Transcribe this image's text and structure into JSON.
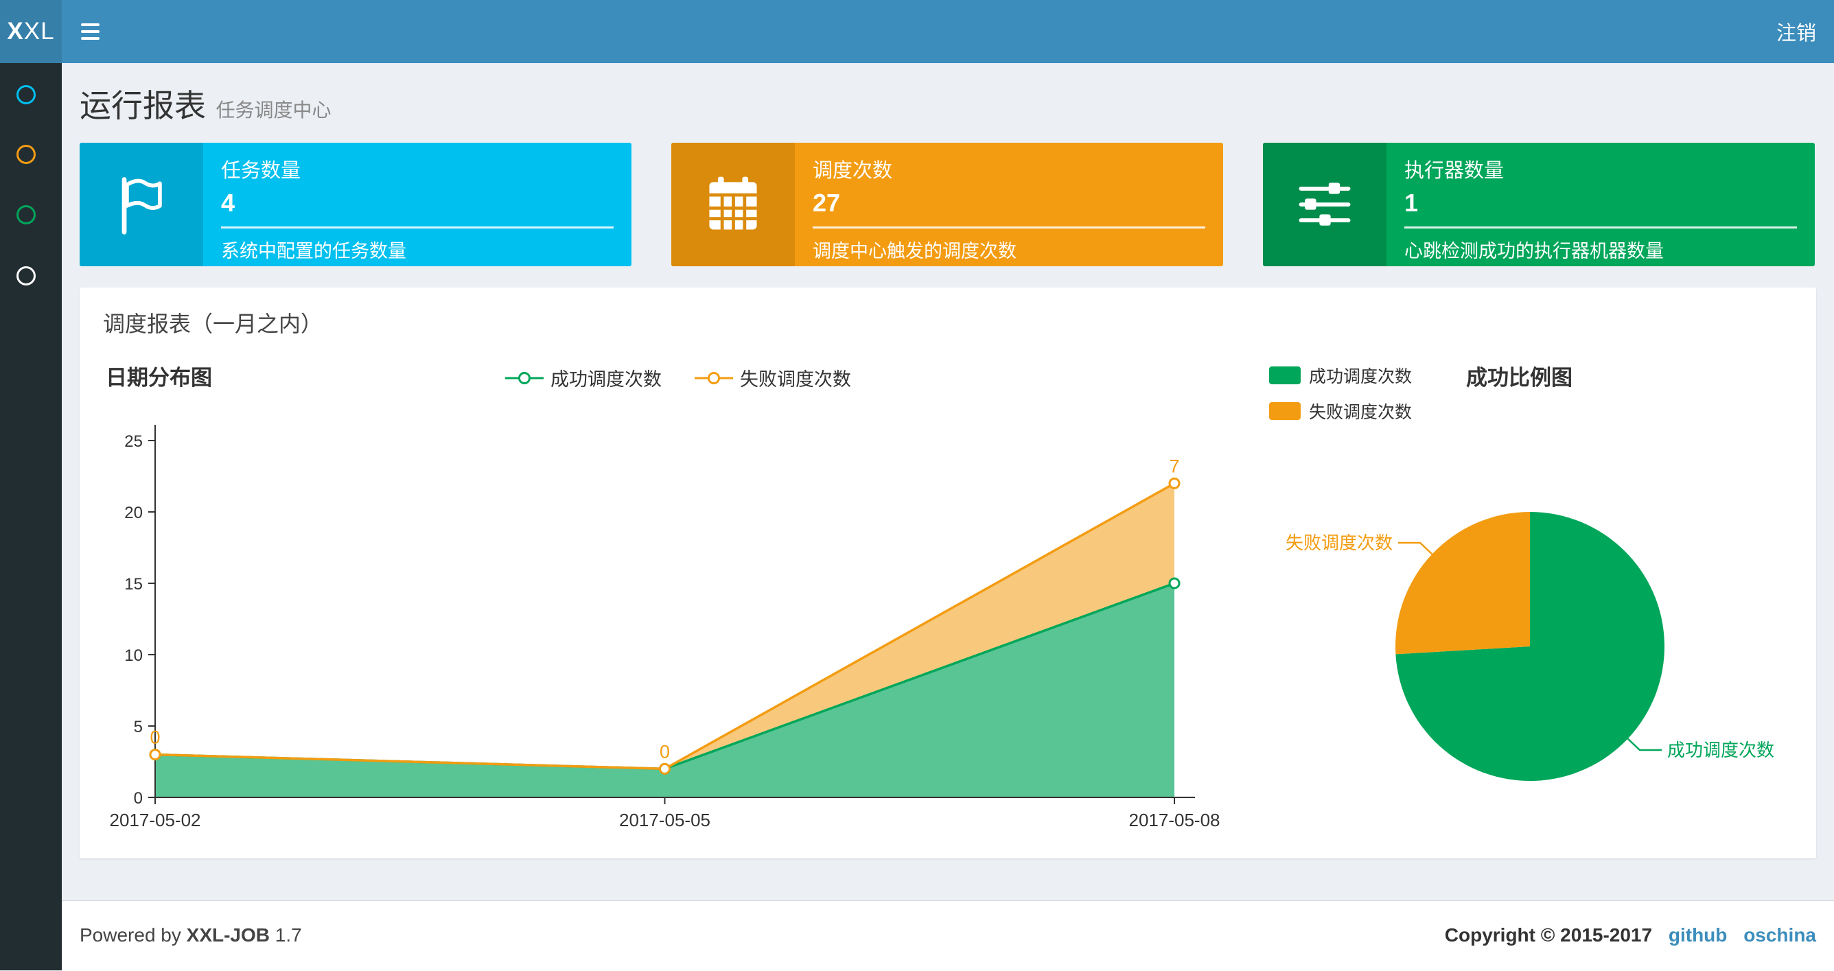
{
  "colors": {
    "navbar_bg": "#3c8dbc",
    "logo_bg": "#367fa9",
    "sidebar_bg": "#222d32",
    "content_bg": "#ecf0f5",
    "link": "#3c8dbc"
  },
  "navbar": {
    "logo_bold": "X",
    "logo_rest": "XL",
    "logout_label": "注销"
  },
  "sidebar": {
    "items": [
      {
        "icon": "circle-icon",
        "color": "#00c0ef"
      },
      {
        "icon": "circle-icon",
        "color": "#f39c12"
      },
      {
        "icon": "circle-icon",
        "color": "#00a65a"
      },
      {
        "icon": "circle-icon",
        "color": "#ffffff"
      }
    ]
  },
  "page_header": {
    "title": "运行报表",
    "subtitle": "任务调度中心"
  },
  "info_boxes": [
    {
      "icon": "flag-icon",
      "label": "任务数量",
      "value": "4",
      "desc": "系统中配置的任务数量",
      "bg": "#00c0ef",
      "icon_bg": "#00a7d0"
    },
    {
      "icon": "calendar-icon",
      "label": "调度次数",
      "value": "27",
      "desc": "调度中心触发的调度次数",
      "bg": "#f39c12",
      "icon_bg": "#db8b0b"
    },
    {
      "icon": "sliders-icon",
      "label": "执行器数量",
      "value": "1",
      "desc": "心跳检测成功的执行器机器数量",
      "bg": "#00a65a",
      "icon_bg": "#008d4c"
    }
  ],
  "panel": {
    "title": "调度报表（一月之内）"
  },
  "chart_data": [
    {
      "type": "area",
      "title": "日期分布图",
      "stacked": true,
      "x": [
        "2017-05-02",
        "2017-05-05",
        "2017-05-08"
      ],
      "series": [
        {
          "name": "成功调度次数",
          "color": "#00a65a",
          "values": [
            3,
            2,
            15
          ]
        },
        {
          "name": "失败调度次数",
          "color": "#f39c12",
          "values": [
            0,
            0,
            7
          ],
          "point_labels": [
            "0",
            "0",
            "7"
          ]
        }
      ],
      "ylim": [
        0,
        25
      ],
      "yticks": [
        0,
        5,
        10,
        15,
        20,
        25
      ],
      "legend_position": "top-center",
      "grid": false
    },
    {
      "type": "pie",
      "title": "成功比例图",
      "slices": [
        {
          "name": "成功调度次数",
          "value": 20,
          "color": "#00a65a"
        },
        {
          "name": "失败调度次数",
          "value": 7,
          "color": "#f39c12"
        }
      ],
      "legend_position": "top-left"
    }
  ],
  "footer": {
    "powered_by": "Powered by",
    "brand": "XXL-JOB",
    "version": "1.7",
    "copyright": "Copyright © 2015-2017",
    "links": [
      "github",
      "oschina"
    ]
  }
}
